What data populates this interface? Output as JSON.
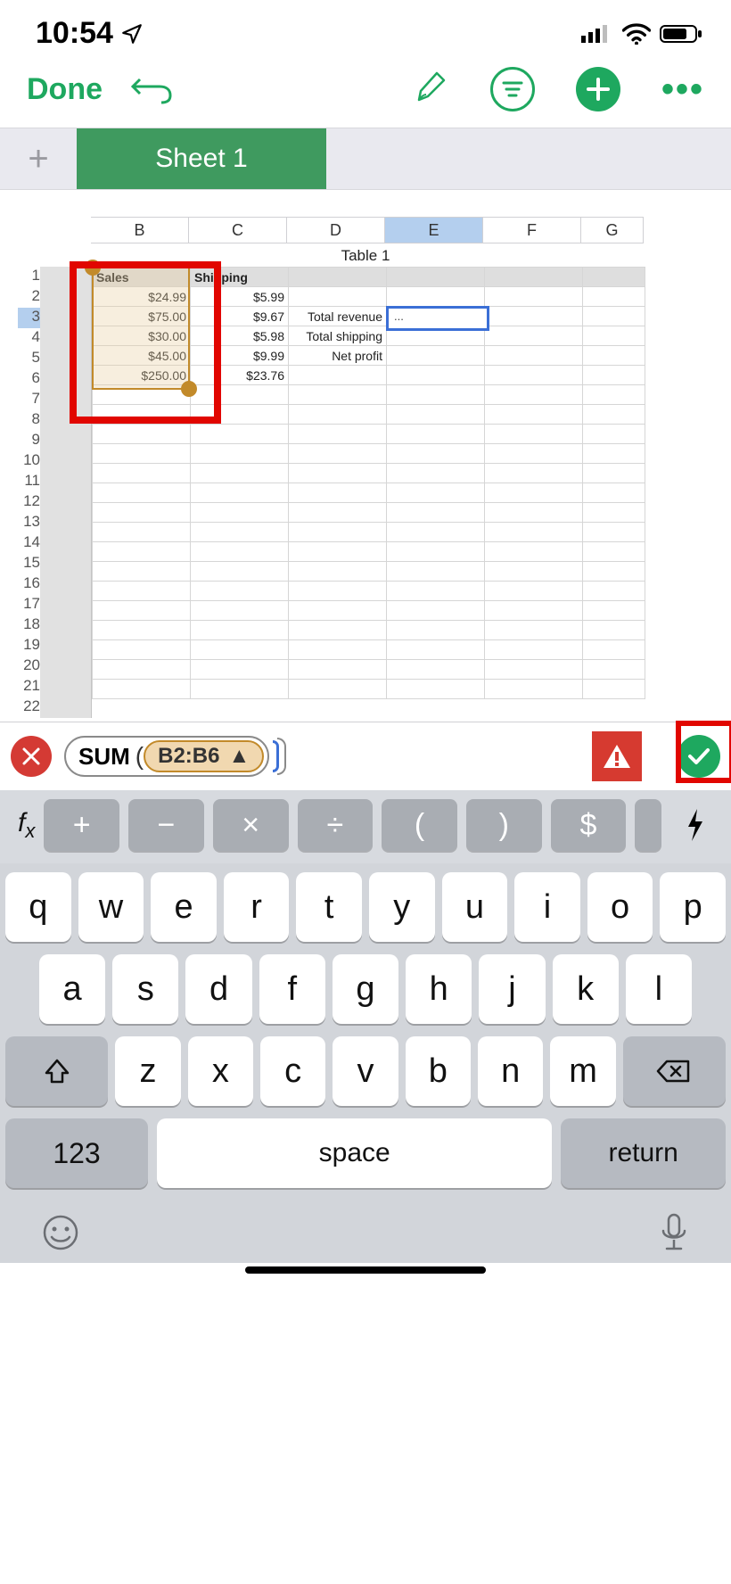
{
  "status": {
    "time": "10:54"
  },
  "toolbar": {
    "done": "Done"
  },
  "sheet_tab": {
    "name": "Sheet 1",
    "table_title": "Table 1"
  },
  "columns": [
    "B",
    "C",
    "D",
    "E",
    "F",
    "G"
  ],
  "selected_column": "E",
  "rows_shown": 22,
  "selected_row": 3,
  "headers": {
    "B": "Sales",
    "C": "Shipping"
  },
  "cells": {
    "B": [
      "$24.99",
      "$75.00",
      "$30.00",
      "$45.00",
      "$250.00"
    ],
    "C": [
      "$5.99",
      "$9.67",
      "$5.98",
      "$9.99",
      "$23.76"
    ],
    "D": [
      "",
      "Total  revenue",
      "Total shipping",
      "Net profit",
      ""
    ],
    "E": [
      "",
      "...",
      "",
      "",
      ""
    ]
  },
  "active_cell": "E3",
  "selection_range": "B1:B6",
  "formula": {
    "function": "SUM",
    "arg_range": "B2:B6",
    "warning": true
  },
  "fx_ops": [
    "+",
    "−",
    "×",
    "÷",
    "(",
    ")",
    "$"
  ],
  "keyboard": {
    "row1": [
      "q",
      "w",
      "e",
      "r",
      "t",
      "y",
      "u",
      "i",
      "o",
      "p"
    ],
    "row2": [
      "a",
      "s",
      "d",
      "f",
      "g",
      "h",
      "j",
      "k",
      "l"
    ],
    "row3": [
      "z",
      "x",
      "c",
      "v",
      "b",
      "n",
      "m"
    ],
    "numKey": "123",
    "space": "space",
    "enter": "return"
  }
}
